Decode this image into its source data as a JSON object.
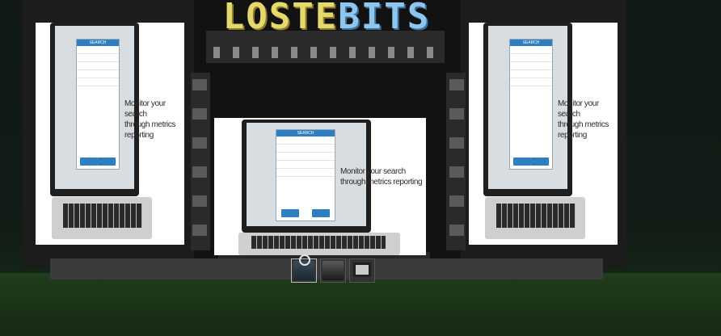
{
  "scene": {
    "logo_text_part1": "LOSTE",
    "logo_text_part2": "BITS"
  },
  "screens": [
    {
      "id": "left-screen",
      "caption_line1": "Monitor your search",
      "caption_line2": "through metrics reporting",
      "dialog_title": "SEARCH"
    },
    {
      "id": "center-screen",
      "caption_line1": "Monitor your search",
      "caption_line2": "through metrics reporting",
      "dialog_title": "SEARCH"
    },
    {
      "id": "right-screen",
      "caption_line1": "Monitor your search",
      "caption_line2": "through metrics reporting",
      "dialog_title": "SEARCH"
    }
  ],
  "hotbar": {
    "slots": [
      {
        "icon": "projector-icon",
        "selected": true
      },
      {
        "icon": "photo-icon",
        "selected": false
      },
      {
        "icon": "monitor-icon",
        "selected": false
      }
    ]
  },
  "colors": {
    "accent": "#2e7fc1",
    "logo_yellow": "#e6d96b",
    "logo_blue": "#8ec6ef"
  }
}
